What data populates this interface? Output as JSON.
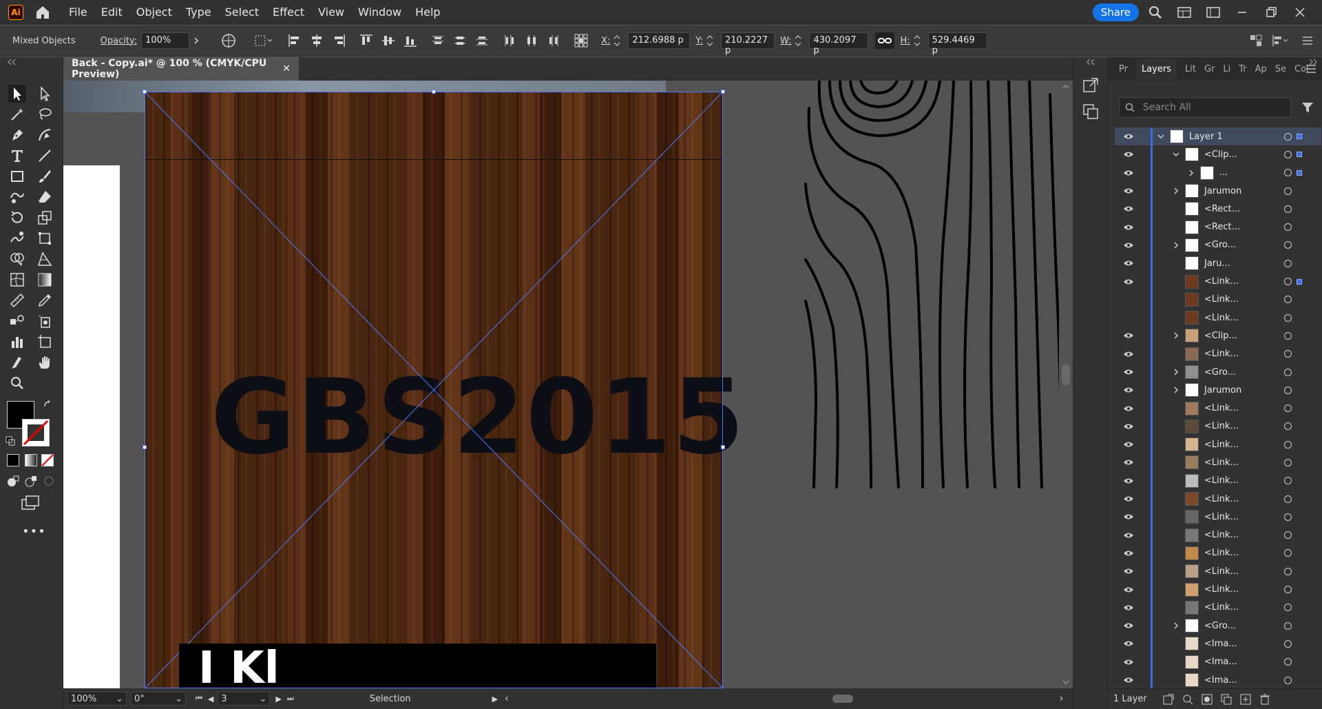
{
  "app": {
    "logo": "Ai"
  },
  "menu": [
    "File",
    "Edit",
    "Object",
    "Type",
    "Select",
    "Effect",
    "View",
    "Window",
    "Help"
  ],
  "header": {
    "share_label": "Share"
  },
  "control": {
    "object_label": "Mixed Objects",
    "opacity_label": "Opacity:",
    "opacity_value": "100%",
    "x_label": "X:",
    "x_value": "212.6988 p",
    "y_label": "Y:",
    "y_value": "210.2227 p",
    "w_label": "W:",
    "w_value": "430.2097 p",
    "h_label": "H:",
    "h_value": "529.4469 p"
  },
  "document": {
    "tab_title": "Back - Copy.ai* @ 100 % (CMYK/CPU Preview)",
    "headline": "GBS2015",
    "partial_text": "I      Kl"
  },
  "status": {
    "zoom": "100%",
    "rotation": "0°",
    "artboard": "3",
    "tool": "Selection"
  },
  "layers_panel": {
    "tabs": [
      "Pr",
      "Layers",
      "Lit",
      "Gr",
      "Li",
      "Tr",
      "Ap",
      "Se",
      "Col"
    ],
    "search_placeholder": "Search All",
    "footer_count": "1 Layer",
    "rows": [
      {
        "name": "Layer 1",
        "indent": 0,
        "expand": "down",
        "eye": true,
        "sel": true
      },
      {
        "name": "<Clip...",
        "indent": 1,
        "expand": "down",
        "eye": true,
        "sel": true
      },
      {
        "name": "...",
        "indent": 2,
        "expand": "right",
        "eye": true,
        "sel": true
      },
      {
        "name": "Jarumon",
        "indent": 1,
        "expand": "right",
        "eye": true
      },
      {
        "name": "<Rect...",
        "indent": 1,
        "expand": "",
        "eye": true
      },
      {
        "name": "<Rect...",
        "indent": 1,
        "expand": "",
        "eye": true
      },
      {
        "name": "<Gro...",
        "indent": 1,
        "expand": "right",
        "eye": true
      },
      {
        "name": "Jaru...",
        "indent": 1,
        "expand": "",
        "eye": true
      },
      {
        "name": "<Link...",
        "indent": 1,
        "expand": "",
        "eye": true,
        "sel": true
      },
      {
        "name": "<Link...",
        "indent": 1,
        "expand": "",
        "eye": false
      },
      {
        "name": "<Link...",
        "indent": 1,
        "expand": "",
        "eye": false
      },
      {
        "name": "<Clip...",
        "indent": 1,
        "expand": "right",
        "eye": true
      },
      {
        "name": "<Link...",
        "indent": 1,
        "expand": "",
        "eye": true
      },
      {
        "name": "<Gro...",
        "indent": 1,
        "expand": "right",
        "eye": true
      },
      {
        "name": "Jarumon",
        "indent": 1,
        "expand": "right",
        "eye": true
      },
      {
        "name": "<Link...",
        "indent": 1,
        "expand": "",
        "eye": true
      },
      {
        "name": "<Link...",
        "indent": 1,
        "expand": "",
        "eye": true
      },
      {
        "name": "<Link...",
        "indent": 1,
        "expand": "",
        "eye": true
      },
      {
        "name": "<Link...",
        "indent": 1,
        "expand": "",
        "eye": true
      },
      {
        "name": "<Link...",
        "indent": 1,
        "expand": "",
        "eye": true
      },
      {
        "name": "<Link...",
        "indent": 1,
        "expand": "",
        "eye": true
      },
      {
        "name": "<Link...",
        "indent": 1,
        "expand": "",
        "eye": true
      },
      {
        "name": "<Link...",
        "indent": 1,
        "expand": "",
        "eye": true
      },
      {
        "name": "<Link...",
        "indent": 1,
        "expand": "",
        "eye": true
      },
      {
        "name": "<Link...",
        "indent": 1,
        "expand": "",
        "eye": true
      },
      {
        "name": "<Link...",
        "indent": 1,
        "expand": "",
        "eye": true
      },
      {
        "name": "<Link...",
        "indent": 1,
        "expand": "",
        "eye": true
      },
      {
        "name": "<Gro...",
        "indent": 1,
        "expand": "right",
        "eye": true
      },
      {
        "name": "<Ima...",
        "indent": 1,
        "expand": "",
        "eye": true
      },
      {
        "name": "<Ima...",
        "indent": 1,
        "expand": "",
        "eye": true
      },
      {
        "name": "<Ima...",
        "indent": 1,
        "expand": "",
        "eye": true
      }
    ]
  },
  "colors": {
    "accent": "#1473e6",
    "selection": "#4b7bff",
    "layer_color": "#3d6de0"
  }
}
